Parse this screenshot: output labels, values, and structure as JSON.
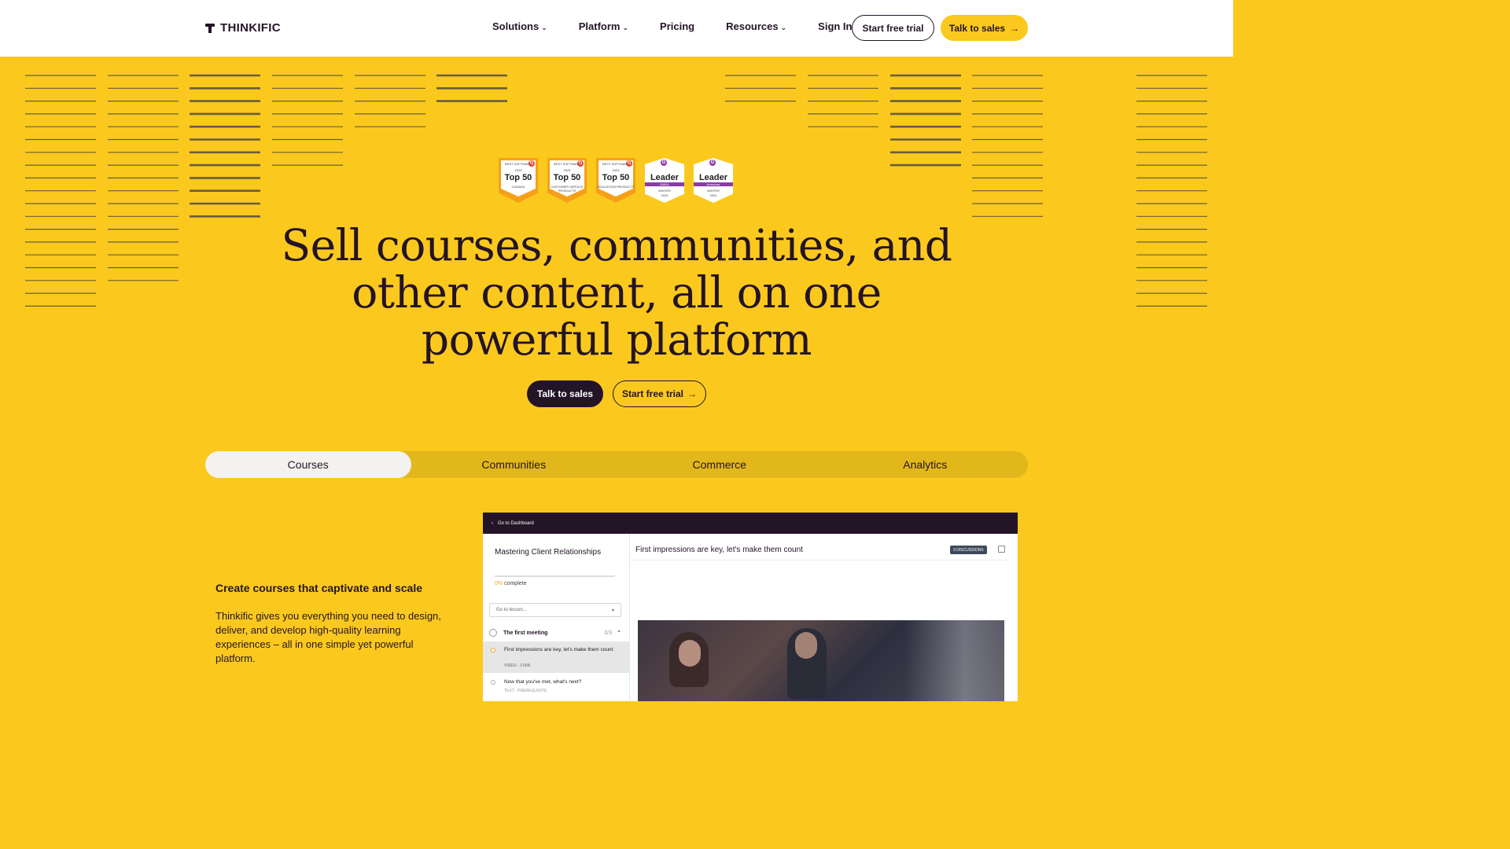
{
  "header": {
    "logo_text": "THINKIFIC",
    "nav": [
      {
        "label": "Solutions",
        "has_dropdown": true
      },
      {
        "label": "Platform",
        "has_dropdown": true
      },
      {
        "label": "Pricing",
        "has_dropdown": false
      },
      {
        "label": "Resources",
        "has_dropdown": true
      },
      {
        "label": "Sign In",
        "has_dropdown": false
      }
    ],
    "start_trial_label": "Start free trial",
    "talk_sales_label": "Talk to sales"
  },
  "badges": [
    {
      "kind": "top50",
      "top": "BEST SOFTWARE",
      "year": "2025",
      "title": "Top 50",
      "sub": "CANADA"
    },
    {
      "kind": "top50",
      "top": "BEST SOFTWARE",
      "year": "2025",
      "title": "Top 50",
      "sub": "CUSTOMER SERVICE PRODUCTS"
    },
    {
      "kind": "top50",
      "top": "BEST SOFTWARE",
      "year": "2025",
      "title": "Top 50",
      "sub": "EDUCATION PRODUCTS"
    },
    {
      "kind": "leader",
      "title": "Leader",
      "region": "EMEA",
      "season": "WINTER",
      "year": "2024"
    },
    {
      "kind": "leader",
      "title": "Leader",
      "region": "Americas",
      "season": "WINTER",
      "year": "2024"
    }
  ],
  "hero": {
    "title_line1": "Sell courses, communities, and",
    "title_line2": "other content, all on one",
    "title_line3": "powerful platform",
    "primary_cta": "Talk to sales",
    "secondary_cta": "Start free trial"
  },
  "tabs": [
    {
      "label": "Courses",
      "active": true
    },
    {
      "label": "Communities",
      "active": false
    },
    {
      "label": "Commerce",
      "active": false
    },
    {
      "label": "Analytics",
      "active": false
    }
  ],
  "feature": {
    "title": "Create courses that captivate and scale",
    "body": "Thinkific gives you everything you need to design, deliver, and develop high-quality learning experiences – all in one simple yet powerful platform."
  },
  "app_preview": {
    "back_label": "Go to Dashboard",
    "course_title": "Mastering Client Relationships",
    "progress_pct": "0%",
    "progress_suffix": "complete",
    "lesson_select_placeholder": "Go to lesson...",
    "chapter_title": "The first meeting",
    "chapter_count": "0/3",
    "active_lesson_title": "First impressions are key, let's make them count",
    "active_lesson_meta": "VIDEO · 3 MIN",
    "next_lesson_title": "Now that you've met, what's next?",
    "next_lesson_meta": "TEXT · PREREQUISITE",
    "main_title": "First impressions are key, let's make them count",
    "discussions_label": "3 DISCUSSIONS"
  },
  "colors": {
    "brand_yellow": "#fbc91e",
    "brand_dark": "#241427",
    "tab_track": "#e2b71c",
    "tab_active": "#f3f2ef"
  }
}
